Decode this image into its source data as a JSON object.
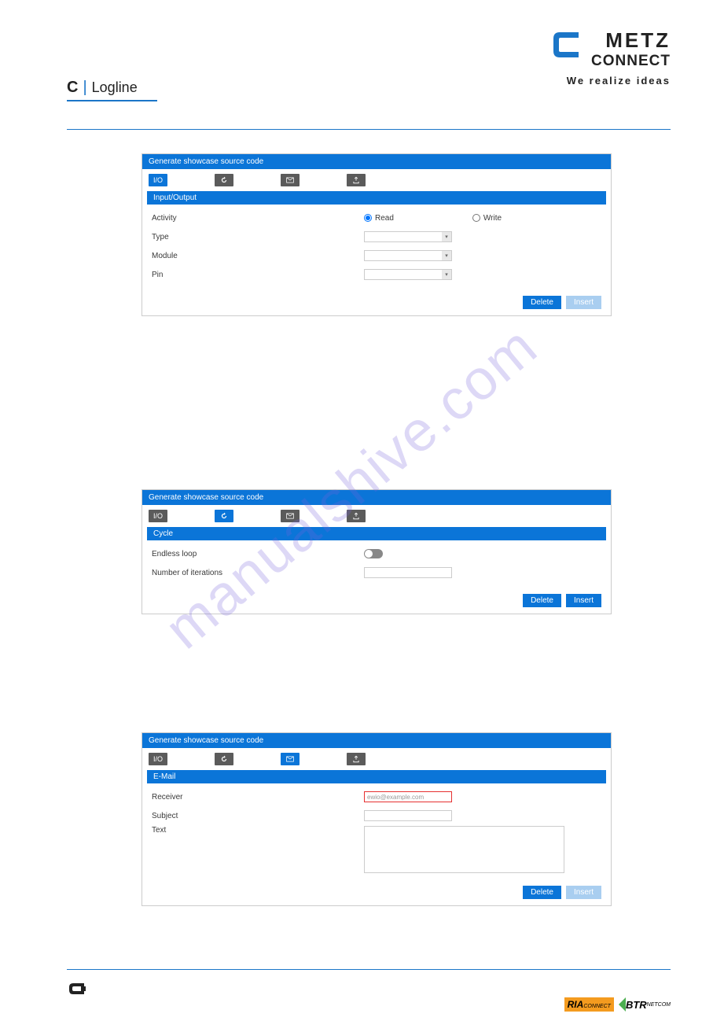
{
  "header": {
    "logo_line1": "METZ",
    "logo_line2": "CONNECT",
    "tagline": "We realize ideas",
    "logline_c": "C",
    "logline_text": "Logline"
  },
  "watermark": "manualshive.com",
  "panels": {
    "p1": {
      "title": "Generate showcase source code",
      "tabs": {
        "io": "I/O"
      },
      "section": "Input/Output",
      "labels": {
        "activity": "Activity",
        "type": "Type",
        "module": "Module",
        "pin": "Pin"
      },
      "radios": {
        "read": "Read",
        "write": "Write"
      },
      "buttons": {
        "delete": "Delete",
        "insert": "Insert"
      }
    },
    "p2": {
      "title": "Generate showcase source code",
      "tabs": {
        "io": "I/O"
      },
      "section": "Cycle",
      "labels": {
        "endless": "Endless loop",
        "iterations": "Number of iterations"
      },
      "buttons": {
        "delete": "Delete",
        "insert": "Insert"
      }
    },
    "p3": {
      "title": "Generate showcase source code",
      "tabs": {
        "io": "I/O"
      },
      "section": "E-Mail",
      "labels": {
        "receiver": "Receiver",
        "subject": "Subject",
        "text": "Text"
      },
      "placeholder": "ewio@example.com",
      "buttons": {
        "delete": "Delete",
        "insert": "Insert"
      }
    }
  },
  "footer": {
    "ria": "RIA",
    "ria_sub": "CONNECT",
    "btr": "BTR",
    "btr_sub": "NETCOM"
  }
}
